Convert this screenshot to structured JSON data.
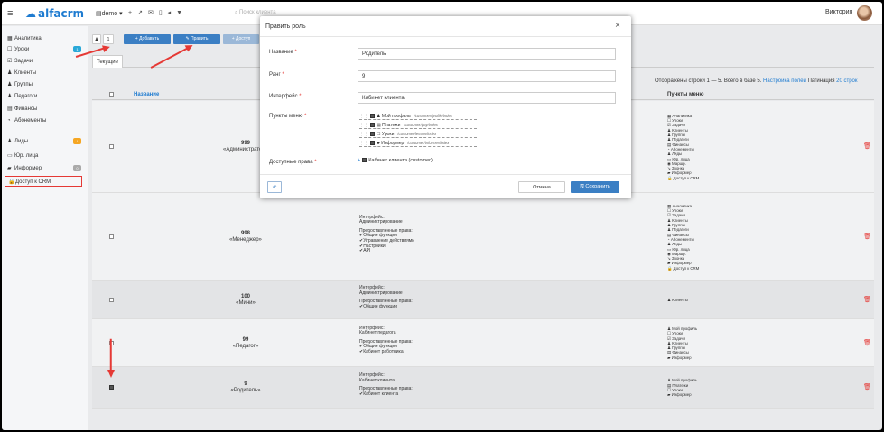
{
  "topbar": {
    "org": "demo",
    "search_placeholder": "Поиск клиента",
    "user": "Виктория"
  },
  "sidebar": {
    "items": [
      {
        "icon": "▦",
        "label": "Аналитика"
      },
      {
        "icon": "☐",
        "label": "Уроки",
        "badge": "1"
      },
      {
        "icon": "☑",
        "label": "Задачи"
      },
      {
        "icon": "♟",
        "label": "Клиенты"
      },
      {
        "icon": "♟",
        "label": "Группы"
      },
      {
        "icon": "♟",
        "label": "Педагоги"
      },
      {
        "icon": "▤",
        "label": "Финансы"
      },
      {
        "icon": "◔",
        "label": "Абонементы"
      },
      {
        "icon": "♟",
        "label": "Лиды",
        "badge": "!"
      },
      {
        "icon": "▭",
        "label": "Юр. лица"
      },
      {
        "icon": "▰",
        "label": "Информер",
        "badge": "0"
      },
      {
        "icon": "🔒",
        "label": "Доступ к CRM"
      }
    ]
  },
  "toolbar": {
    "page1": "1",
    "page2": "1",
    "add": "+ Добавить",
    "edit": "✎ Править",
    "other": "+ Доступ"
  },
  "tabs": {
    "current": "Текущие"
  },
  "pager": {
    "shown": "Отображены строки 1 — 5. Всего в базе 5.",
    "settings": "Настройка полей",
    "pagination": "Пагинация",
    "per_page": "20 строк"
  },
  "table": {
    "col_name": "Название",
    "col_menu": "Пункты меню",
    "rows": [
      {
        "rank": "999",
        "name": "«Администратор»",
        "iface_label": "",
        "iface": "",
        "rights_label": "",
        "rights": [],
        "menu": [
          "▦ Аналитика",
          "☐ Уроки",
          "☑ Задачи",
          "♟ Клиенты",
          "♟ Группы",
          "♟ Педагоги",
          "▤ Финансы",
          "◔ Абонементы",
          "♟ Лиды",
          "▭ Юр. лица",
          "◉ Маршр.",
          "↘ Звонки",
          "▰ Информер",
          "🔒 Доступ к CRM"
        ]
      },
      {
        "rank": "998",
        "name": "«Менеджер»",
        "iface_label": "Интерфейс:",
        "iface": "Администрирование",
        "rights_label": "Предоставленные права:",
        "rights": [
          "✔Общие функции",
          "✔Управление действиями",
          "✔Настройки",
          "✔API"
        ],
        "menu": [
          "▦ Аналитика",
          "☐ Уроки",
          "☑ Задачи",
          "♟ Клиенты",
          "♟ Группы",
          "♟ Педагоги",
          "▤ Финансы",
          "◔ Абонементы",
          "♟ Лиды",
          "▭ Юр. лица",
          "◉ Маршр.",
          "↘ Звонки",
          "▰ Информер",
          "🔒 Доступ к CRM"
        ]
      },
      {
        "rank": "100",
        "name": "«Мини»",
        "iface_label": "Интерфейс:",
        "iface": "Администрирование",
        "rights_label": "Предоставленные права:",
        "rights": [
          "✔Общие функции"
        ],
        "menu": [
          "♟ Клиенты"
        ]
      },
      {
        "rank": "99",
        "name": "«Педагог»",
        "iface_label": "Интерфейс:",
        "iface": "Кабинет педагога",
        "rights_label": "Предоставленные права:",
        "rights": [
          "✔Общие функции",
          "✔Кабинет работника"
        ],
        "menu": [
          "♟ Мой профиль",
          "☐ Уроки",
          "☑ Задачи",
          "♟ Клиенты",
          "♟ Группы",
          "▤ Финансы",
          "▰ Информер"
        ]
      },
      {
        "rank": "9",
        "name": "«Родитель»",
        "iface_label": "Интерфейс:",
        "iface": "Кабинет клиента",
        "rights_label": "Предоставленные права:",
        "rights": [
          "✔Кабинет клиента"
        ],
        "menu": [
          "♟ Мой профиль",
          "▤ Платежи",
          "☐ Уроки",
          "▰ Информер"
        ]
      }
    ]
  },
  "modal": {
    "title": "Править роль",
    "close": "×",
    "name_label": "Название",
    "name_value": "Родитель",
    "rank_label": "Ранг",
    "rank_value": "9",
    "iface_label": "Интерфейс",
    "iface_value": "Кабинет клиента",
    "menu_label": "Пункты меню",
    "menu_items": [
      {
        "label": "♟ Мой профиль",
        "path": "/customer/profile/index"
      },
      {
        "label": "▤ Платежи",
        "path": "/customer/pay/index"
      },
      {
        "label": "☐ Уроки",
        "path": "/customer/lesson/index"
      },
      {
        "label": "▰ Информер",
        "path": "/customer/informer/index"
      }
    ],
    "rights_label": "Доступные права",
    "rights_value": "Кабинет клиента (customer)",
    "cancel": "Отмена",
    "save": "🖫 Сохранить",
    "reset": "↶"
  },
  "colors": {
    "brand": "#1e7bd0",
    "button": "#3b7fc4",
    "danger": "#e53935"
  }
}
